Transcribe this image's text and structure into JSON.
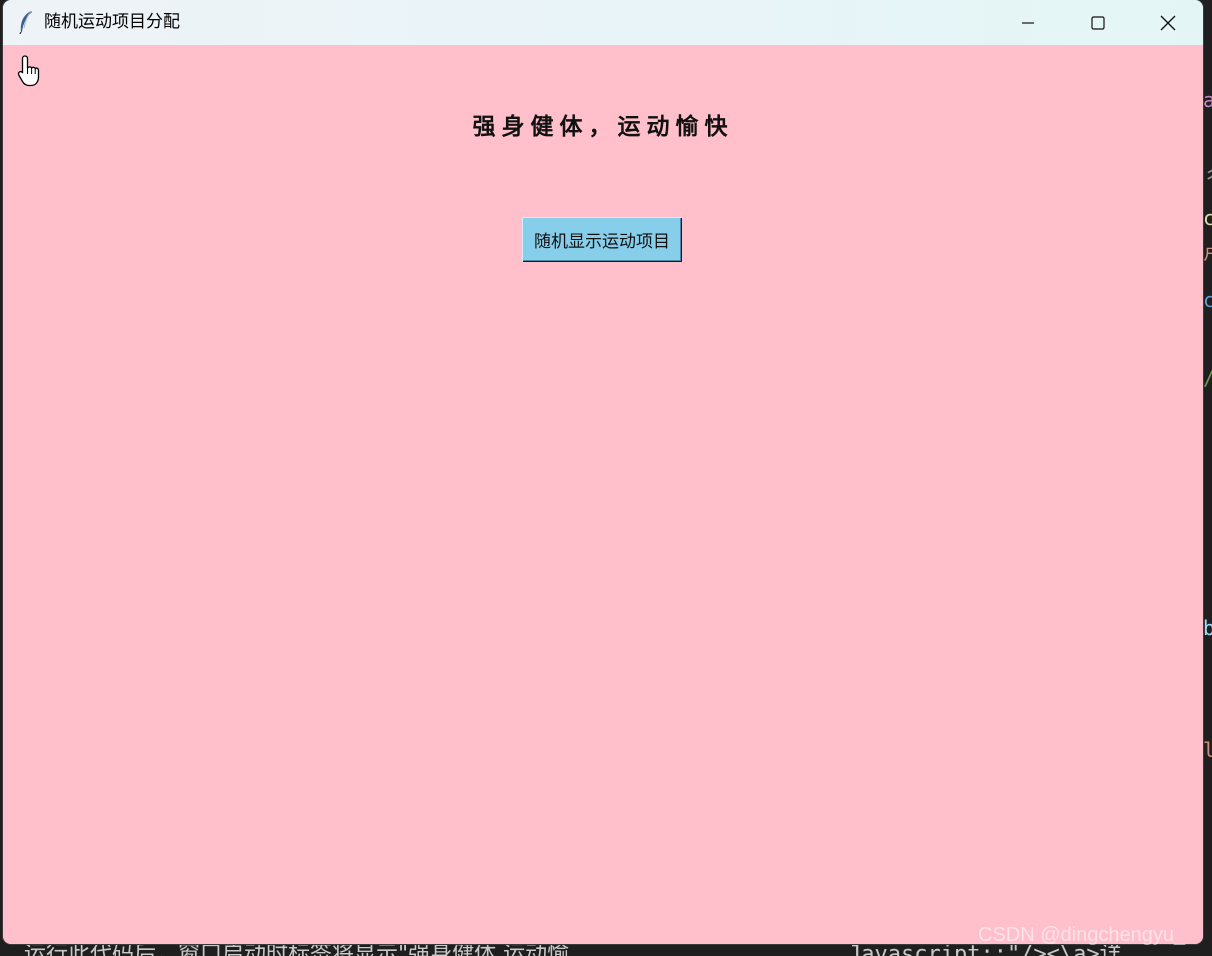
{
  "window": {
    "title": "随机运动项目分配",
    "background_color": "#ffc0cb",
    "titlebar_icons": [
      "feather-icon",
      "minimize-icon",
      "maximize-icon",
      "close-icon"
    ]
  },
  "main": {
    "heading": "强身健体，运动愉快",
    "button_label": "随机显示运动项目",
    "button_color": "#87ceeb"
  },
  "background": {
    "bottom_caption": "运行此代码后，窗口启动时标签将显示\"强身健体 运动愉",
    "bottom_code": "Javascript:;\"/><\\a>详",
    "watermark": "CSDN @dingchengyu_"
  }
}
